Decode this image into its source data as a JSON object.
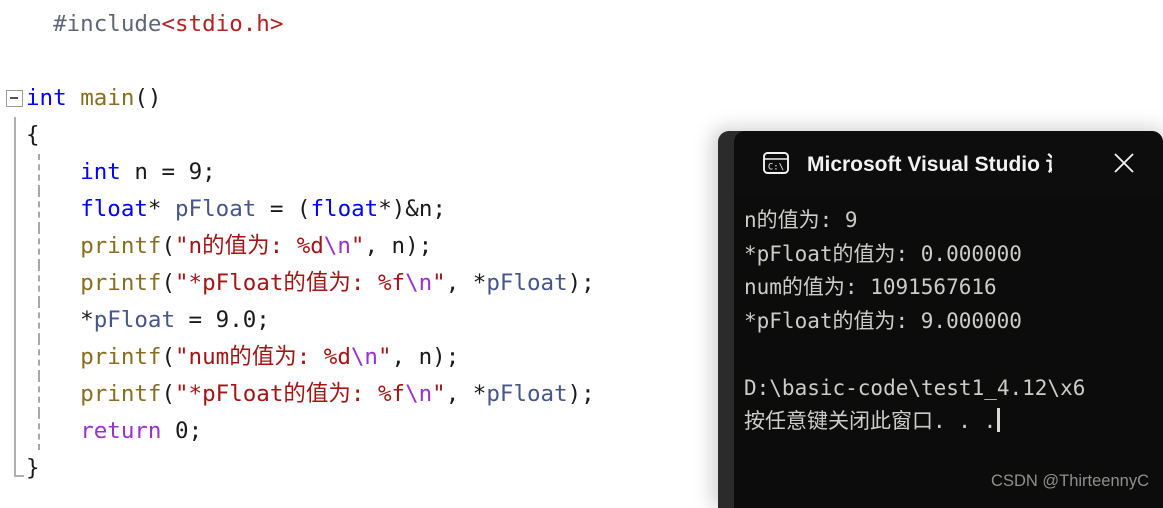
{
  "editor": {
    "lines": [
      {
        "gutter": "none",
        "indent_guide": false,
        "tokens": [
          {
            "text": "  ",
            "cls": "t-plain"
          },
          {
            "text": "#include",
            "cls": "t-pre"
          },
          {
            "text": "<stdio.h>",
            "cls": "t-header"
          }
        ]
      },
      {
        "gutter": "none",
        "indent_guide": false,
        "tokens": []
      },
      {
        "gutter": "fold",
        "indent_guide": false,
        "tokens": [
          {
            "text": "int",
            "cls": "t-kw"
          },
          {
            "text": " ",
            "cls": "t-plain"
          },
          {
            "text": "main",
            "cls": "t-fn"
          },
          {
            "text": "()",
            "cls": "t-plain"
          }
        ]
      },
      {
        "gutter": "bar",
        "indent_guide": false,
        "tokens": [
          {
            "text": "{",
            "cls": "t-plain"
          }
        ]
      },
      {
        "gutter": "bar",
        "indent_guide": true,
        "tokens": [
          {
            "text": "    ",
            "cls": "t-plain"
          },
          {
            "text": "int",
            "cls": "t-kw"
          },
          {
            "text": " n = ",
            "cls": "t-plain"
          },
          {
            "text": "9",
            "cls": "t-num"
          },
          {
            "text": ";",
            "cls": "t-plain"
          }
        ]
      },
      {
        "gutter": "bar",
        "indent_guide": true,
        "tokens": [
          {
            "text": "    ",
            "cls": "t-plain"
          },
          {
            "text": "float",
            "cls": "t-kw"
          },
          {
            "text": "* ",
            "cls": "t-plain"
          },
          {
            "text": "pFloat",
            "cls": "t-ident"
          },
          {
            "text": " = (",
            "cls": "t-plain"
          },
          {
            "text": "float",
            "cls": "t-kw"
          },
          {
            "text": "*)&n;",
            "cls": "t-plain"
          }
        ]
      },
      {
        "gutter": "bar",
        "indent_guide": true,
        "tokens": [
          {
            "text": "    ",
            "cls": "t-plain"
          },
          {
            "text": "printf",
            "cls": "t-fn"
          },
          {
            "text": "(",
            "cls": "t-plain"
          },
          {
            "text": "\"n的值为: %d",
            "cls": "t-str"
          },
          {
            "text": "\\n",
            "cls": "t-esc"
          },
          {
            "text": "\"",
            "cls": "t-str"
          },
          {
            "text": ", n);",
            "cls": "t-plain"
          }
        ]
      },
      {
        "gutter": "bar",
        "indent_guide": true,
        "tokens": [
          {
            "text": "    ",
            "cls": "t-plain"
          },
          {
            "text": "printf",
            "cls": "t-fn"
          },
          {
            "text": "(",
            "cls": "t-plain"
          },
          {
            "text": "\"*pFloat的值为: %f",
            "cls": "t-str"
          },
          {
            "text": "\\n",
            "cls": "t-esc"
          },
          {
            "text": "\"",
            "cls": "t-str"
          },
          {
            "text": ", *",
            "cls": "t-plain"
          },
          {
            "text": "pFloat",
            "cls": "t-ident"
          },
          {
            "text": ");",
            "cls": "t-plain"
          }
        ]
      },
      {
        "gutter": "bar",
        "indent_guide": true,
        "tokens": [
          {
            "text": "    *",
            "cls": "t-plain"
          },
          {
            "text": "pFloat",
            "cls": "t-ident"
          },
          {
            "text": " = ",
            "cls": "t-plain"
          },
          {
            "text": "9.0",
            "cls": "t-num"
          },
          {
            "text": ";",
            "cls": "t-plain"
          }
        ]
      },
      {
        "gutter": "bar",
        "indent_guide": true,
        "tokens": [
          {
            "text": "    ",
            "cls": "t-plain"
          },
          {
            "text": "printf",
            "cls": "t-fn"
          },
          {
            "text": "(",
            "cls": "t-plain"
          },
          {
            "text": "\"num的值为: %d",
            "cls": "t-str"
          },
          {
            "text": "\\n",
            "cls": "t-esc"
          },
          {
            "text": "\"",
            "cls": "t-str"
          },
          {
            "text": ", n);",
            "cls": "t-plain"
          }
        ]
      },
      {
        "gutter": "bar",
        "indent_guide": true,
        "tokens": [
          {
            "text": "    ",
            "cls": "t-plain"
          },
          {
            "text": "printf",
            "cls": "t-fn"
          },
          {
            "text": "(",
            "cls": "t-plain"
          },
          {
            "text": "\"*pFloat的值为: %f",
            "cls": "t-str"
          },
          {
            "text": "\\n",
            "cls": "t-esc"
          },
          {
            "text": "\"",
            "cls": "t-str"
          },
          {
            "text": ", *",
            "cls": "t-plain"
          },
          {
            "text": "pFloat",
            "cls": "t-ident"
          },
          {
            "text": ");",
            "cls": "t-plain"
          }
        ]
      },
      {
        "gutter": "bar",
        "indent_guide": true,
        "tokens": [
          {
            "text": "    ",
            "cls": "t-plain"
          },
          {
            "text": "return",
            "cls": "t-ret"
          },
          {
            "text": " ",
            "cls": "t-plain"
          },
          {
            "text": "0",
            "cls": "t-num"
          },
          {
            "text": ";",
            "cls": "t-plain"
          }
        ]
      },
      {
        "gutter": "bar-end",
        "indent_guide": false,
        "tokens": [
          {
            "text": "}",
            "cls": "t-plain"
          }
        ]
      }
    ]
  },
  "console": {
    "title": "Microsoft Visual Studio 调试控制台",
    "icon": "console-window-icon",
    "close_label": "✕",
    "output": [
      "n的值为: 9",
      "*pFloat的值为: 0.000000",
      "num的值为: 1091567616",
      "*pFloat的值为: 9.000000",
      "",
      "D:\\basic-code\\test1_4.12\\x6",
      "按任意键关闭此窗口. . ."
    ],
    "cursor_on_line": 6,
    "colors": {
      "frame": "#2b2b2b",
      "titlebar": "#0d0d0d",
      "body": "#0c0c0c",
      "text": "#ccccc9"
    }
  },
  "watermark": {
    "text": "CSDN @ThirteennyC"
  }
}
